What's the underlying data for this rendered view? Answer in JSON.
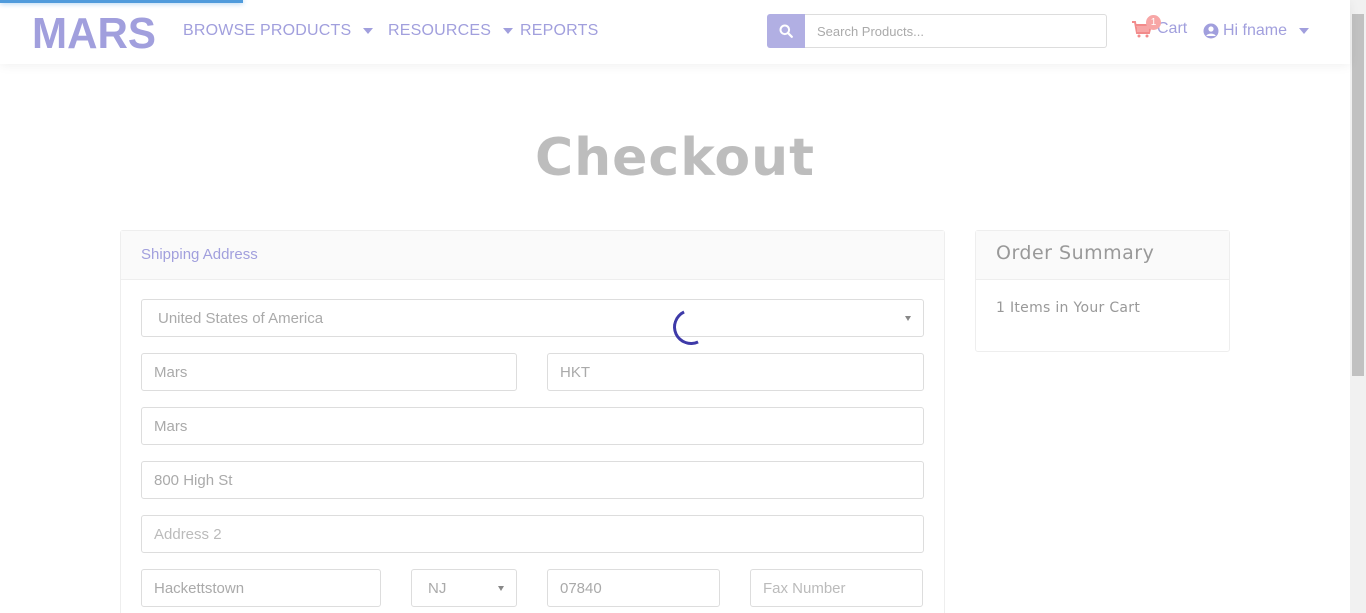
{
  "brand": {
    "logo_text": "MARS",
    "accent_color": "#a19fdd"
  },
  "nav": {
    "items": [
      {
        "label": "BROWSE PRODUCTS",
        "has_dropdown": true
      },
      {
        "label": "RESOURCES",
        "has_dropdown": true
      },
      {
        "label": "REPORTS",
        "has_dropdown": false
      }
    ],
    "search": {
      "placeholder": "Search Products...",
      "icon": "search-icon"
    },
    "cart": {
      "label": "Cart",
      "count": "1",
      "icon": "cart-icon"
    },
    "user": {
      "greeting": "Hi fname",
      "icon": "user-circle-icon"
    }
  },
  "page": {
    "title": "Checkout"
  },
  "shipping": {
    "heading": "Shipping Address",
    "country": "United States of America",
    "first_name": "Mars",
    "last_name": "HKT",
    "company": "Mars",
    "address1": "800 High St",
    "address2_placeholder": "Address 2",
    "city": "Hackettstown",
    "state": "NJ",
    "zip": "07840",
    "fax_placeholder": "Fax Number"
  },
  "summary": {
    "heading": "Order Summary",
    "items_text": "1 Items in Your Cart"
  }
}
